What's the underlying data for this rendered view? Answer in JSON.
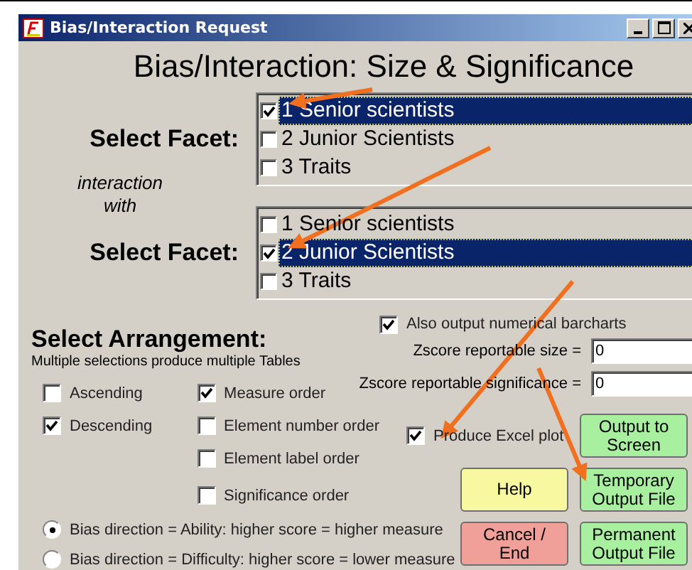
{
  "window": {
    "title": "Bias/Interaction Request"
  },
  "heading": "Bias/Interaction: Size & Significance",
  "facet_selectors": [
    {
      "label": "Select Facet:",
      "items": [
        {
          "label": "1 Senior scientists",
          "checked": true,
          "selected": true
        },
        {
          "label": "2 Junior Scientists",
          "checked": false,
          "selected": false
        },
        {
          "label": "3 Traits",
          "checked": false,
          "selected": false
        }
      ]
    },
    {
      "label": "Select Facet:",
      "items": [
        {
          "label": "1 Senior scientists",
          "checked": false,
          "selected": false
        },
        {
          "label": "2 Junior Scientists",
          "checked": true,
          "selected": true
        },
        {
          "label": "3 Traits",
          "checked": false,
          "selected": false
        }
      ]
    }
  ],
  "connector": [
    "interaction",
    "with"
  ],
  "also_output": {
    "label": "Also output numerical barcharts",
    "checked": true
  },
  "arrangement": {
    "title": "Select Arrangement:",
    "subtitle": "Multiple selections produce multiple Tables",
    "direction_options": [
      {
        "label": "Ascending",
        "checked": false
      },
      {
        "label": "Descending",
        "checked": true
      }
    ],
    "order_options": [
      {
        "label": "Measure order",
        "checked": true
      },
      {
        "label": "Element number order",
        "checked": false
      },
      {
        "label": "Element label order",
        "checked": false
      },
      {
        "label": "Significance order",
        "checked": false
      }
    ]
  },
  "bias_direction": [
    {
      "label": "Bias direction = Ability: higher score = higher measure",
      "selected": true
    },
    {
      "label": "Bias direction = Difficulty: higher score = lower measure",
      "selected": false
    }
  ],
  "zscore_fields": [
    {
      "label": "Zscore reportable size =",
      "value": "0"
    },
    {
      "label": "Zscore reportable significance =",
      "value": "0"
    }
  ],
  "excel_plot": {
    "label": "Produce Excel plot",
    "checked": true
  },
  "buttons": [
    {
      "label": "Output to Screen",
      "kind": "output"
    },
    {
      "label": "Help",
      "kind": "help"
    },
    {
      "label": "Temporary Output File",
      "kind": "output"
    },
    {
      "label": "Cancel / End",
      "kind": "cancel"
    },
    {
      "label": "Permanent Output File",
      "kind": "output"
    }
  ]
}
